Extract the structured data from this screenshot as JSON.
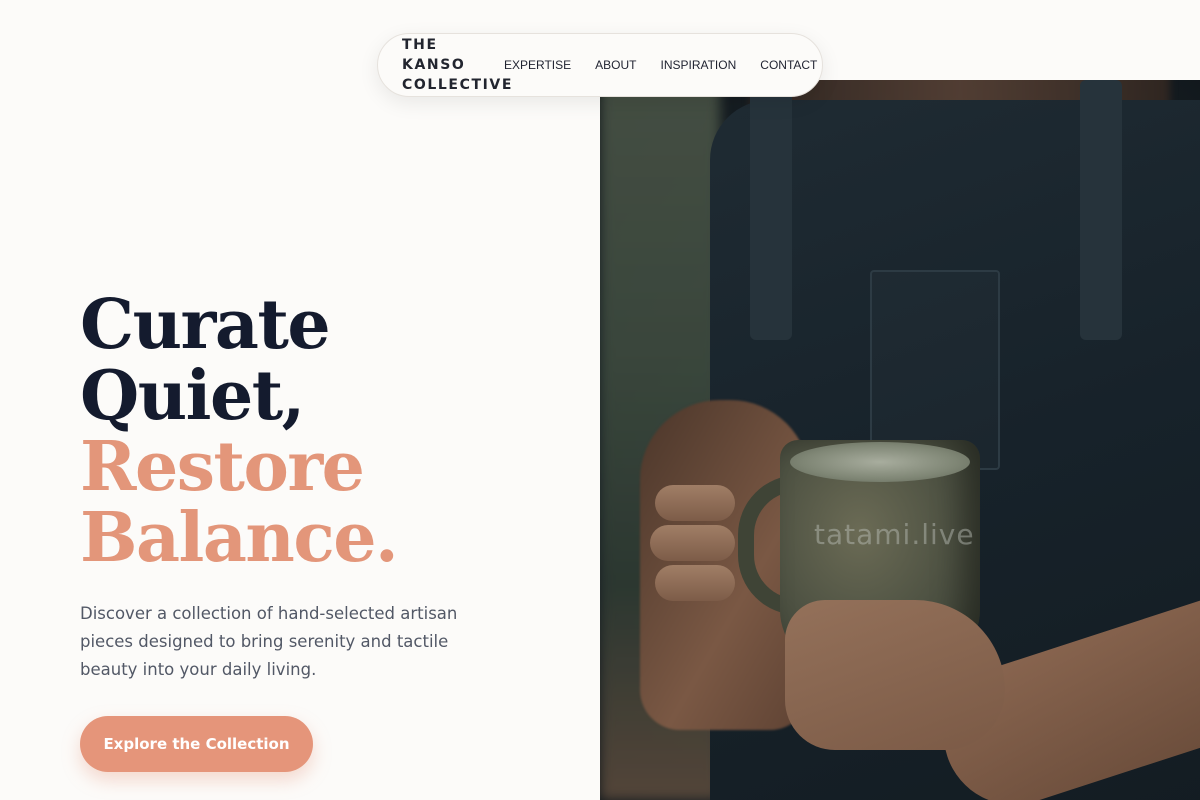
{
  "nav": {
    "brand_line1": "THE KANSO",
    "brand_line2": "COLLECTIVE",
    "links": [
      {
        "label": "EXPERTISE"
      },
      {
        "label": "ABOUT"
      },
      {
        "label": "INSPIRATION"
      },
      {
        "label": "CONTACT"
      }
    ]
  },
  "hero": {
    "headline_line1": "Curate",
    "headline_line2": "Quiet,",
    "headline_line3": "Restore",
    "headline_line4": "Balance.",
    "description": "Discover a collection of hand-selected artisan pieces designed to bring serenity and tactile beauty into your daily living.",
    "cta_label": "Explore the Collection"
  },
  "image": {
    "watermark": "tatami.live"
  },
  "colors": {
    "background": "#fcfbf9",
    "headline_dark": "#141b2e",
    "accent": "#e5957a",
    "body_text": "#525866"
  }
}
